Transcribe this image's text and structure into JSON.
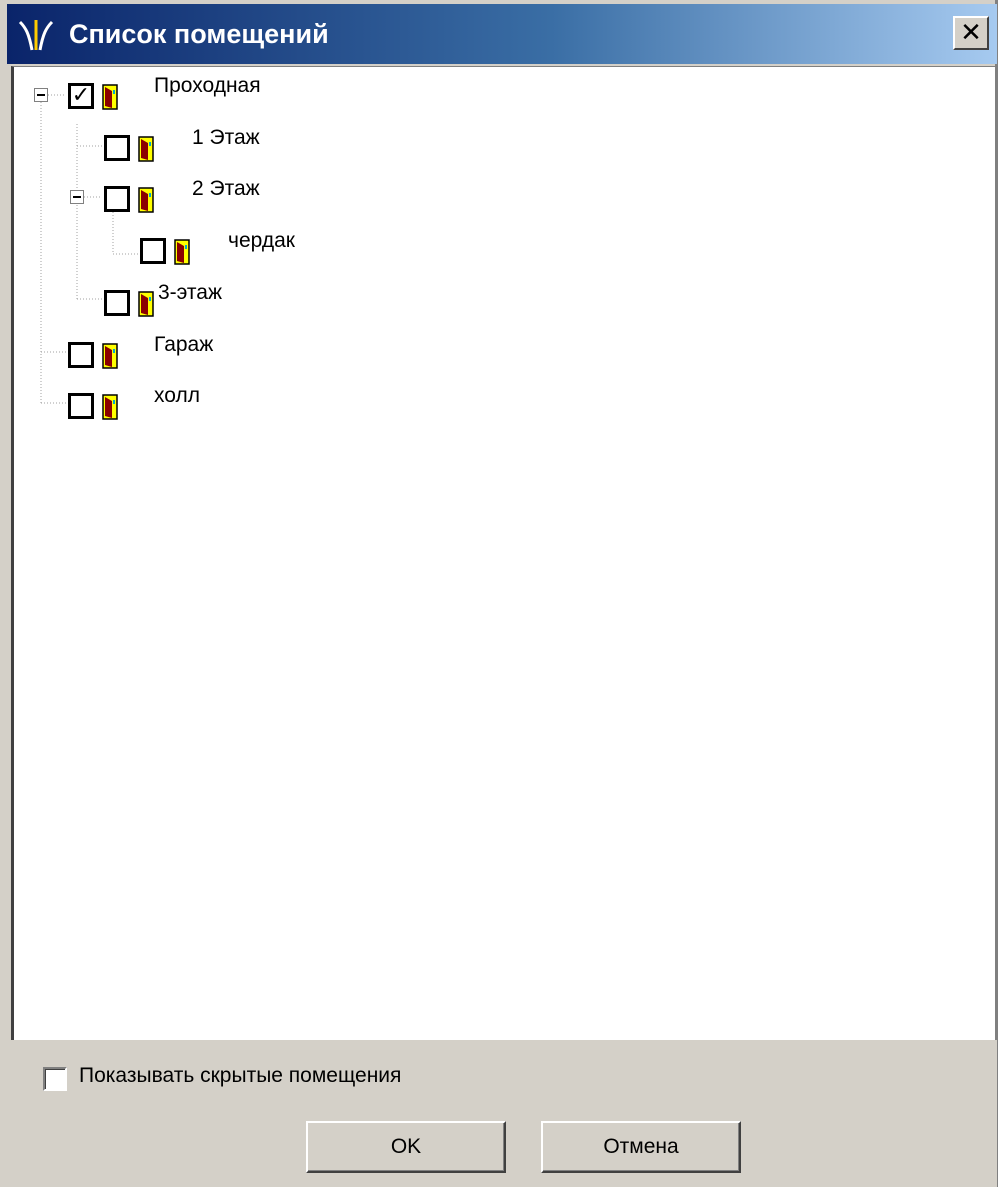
{
  "window": {
    "title": "Список помещений",
    "close_label": "✕"
  },
  "tree": {
    "expander_icon": "minus-box-icon",
    "room_icon": "door-icon",
    "nodes": [
      {
        "label": "Проходная",
        "checked": true
      },
      {
        "label": "1 Этаж",
        "checked": false
      },
      {
        "label": "2 Этаж",
        "checked": false
      },
      {
        "label": "чердак",
        "checked": false
      },
      {
        "label": "3-этаж",
        "checked": false
      },
      {
        "label": "Гараж",
        "checked": false
      },
      {
        "label": "холл",
        "checked": false
      }
    ]
  },
  "footer": {
    "show_hidden_label": "Показывать скрытые помещения",
    "show_hidden_checked": false,
    "ok_label": "OK",
    "cancel_label": "Отмена"
  },
  "colors": {
    "titlebar_start": "#0a246a",
    "titlebar_end": "#a6caf0",
    "face": "#d4d0c8",
    "door_fill": "#ffff00",
    "door_dark": "#8b0000"
  }
}
